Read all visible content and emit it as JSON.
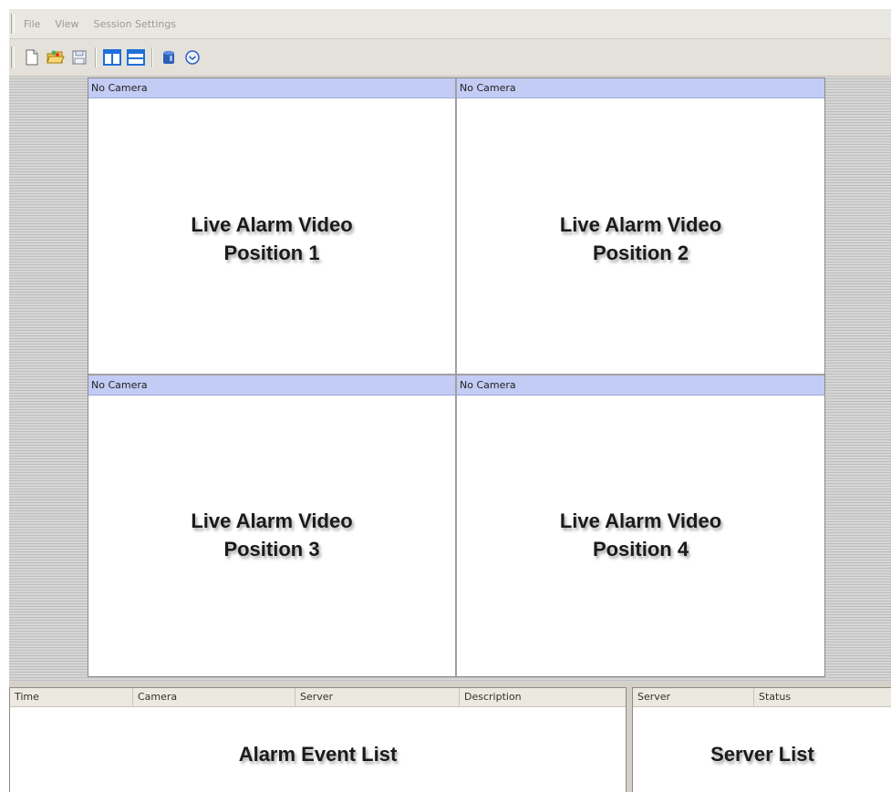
{
  "menu": {
    "items": [
      "File",
      "View",
      "Session Settings"
    ]
  },
  "toolbar": {
    "icons": [
      "new-document-icon",
      "open-folder-icon",
      "save-icon",
      "split-vertical-icon",
      "split-horizontal-icon",
      "database-icon",
      "clock-icon"
    ]
  },
  "video_panes": [
    {
      "header": "No Camera",
      "line1": "Live Alarm Video",
      "line2": "Position 1"
    },
    {
      "header": "No Camera",
      "line1": "Live Alarm Video",
      "line2": "Position 2"
    },
    {
      "header": "No Camera",
      "line1": "Live Alarm Video",
      "line2": "Position 3"
    },
    {
      "header": "No Camera",
      "line1": "Live Alarm Video",
      "line2": "Position 4"
    }
  ],
  "alarm_list": {
    "columns": [
      "Time",
      "Camera",
      "Server",
      "Description"
    ],
    "label": "Alarm Event List"
  },
  "server_list": {
    "columns": [
      "Server",
      "Status"
    ],
    "label": "Server List"
  },
  "colors": {
    "pane_header": "#c2ccf4",
    "background": "#dcd8d0"
  }
}
